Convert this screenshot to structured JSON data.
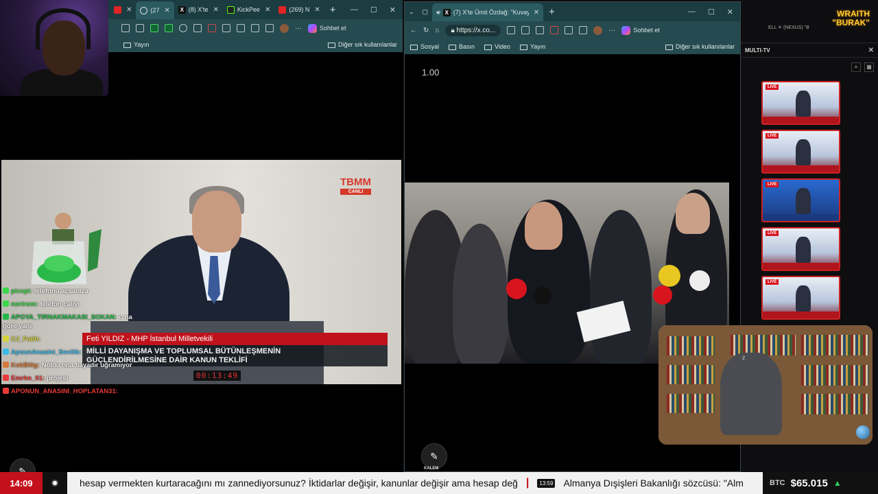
{
  "left_browser": {
    "tabs": [
      {
        "label": "(27",
        "icon": "youtube-icon"
      },
      {
        "label": "(8) X'te",
        "icon": "x-logo-icon"
      },
      {
        "label": "KickPee",
        "icon": "kick-icon"
      },
      {
        "label": "(269) N",
        "icon": "youtube-icon"
      }
    ],
    "sohbet_label": "Sohbet et",
    "bookmarks": [
      {
        "label": "Yayın"
      }
    ],
    "bookmarks_other": "Diğer sık kullanılanlar"
  },
  "right_browser": {
    "tabs": [
      {
        "label": "(7) X'te Ümit Özdağ: \"Kuvay-",
        "icon": "x-logo-icon"
      }
    ],
    "url": "https://x.co...",
    "sohbet_label": "Sohbet et",
    "bookmarks": [
      {
        "label": "Sosyal"
      },
      {
        "label": "Basın"
      },
      {
        "label": "Video"
      },
      {
        "label": "Yayın"
      }
    ],
    "bookmarks_other": "Diğer sık kullanılanlar",
    "zoom": "1.00"
  },
  "tbmm": {
    "logo": "TBMM",
    "logo_sub": "CANLI",
    "speaker_name": "Feti YILDIZ - MHP İstanbul Milletvekili",
    "bill_title_1": "MİLLİ DAYANIŞMA VE TOPLUMSAL BÜTÜNLEŞMENİN",
    "bill_title_2": "GÜÇLENDİRİLMESİNE DAİR KANUN TEKLİFİ",
    "clock": "00:13:49"
  },
  "chat": [
    {
      "user": "piccpi:",
      "text": "telefonu açsanıza",
      "color": "#3ad84a"
    },
    {
      "user": "nortrom:",
      "text": "telefon çalıyı",
      "color": "#3ad84a"
    },
    {
      "user": "APOYA_TIRNAKMAKASI_SOKAN:",
      "text": "o na gore yani",
      "color": "#26b84a"
    },
    {
      "user": "CJ_Fatih:",
      "text": "",
      "color": "#d4d43a"
    },
    {
      "user": "ApounAnasini_Sevilik:",
      "text": "",
      "color": "#3ab8e8"
    },
    {
      "user": "KokBilig:",
      "text": "Noldu ona bayadır uğramıyor",
      "color": "#d87a3a"
    },
    {
      "user": "Emrhn_01:",
      "text": "projesi",
      "color": "#e83a3a"
    },
    {
      "user": "APONUN_ANASINI_HOPLATAN31:",
      "text": "",
      "color": "#e83a3a"
    }
  ],
  "right_panel": {
    "title": "MULTI-TV",
    "top_text": "ELL   ✕ (NEXUS) \"B",
    "brand_1": "WRAITH",
    "brand_2": "\"BURAK\"",
    "live_label": "LIVE",
    "add_label": "+",
    "close_label": "✕"
  },
  "ticker": {
    "time": "14:09",
    "headline_1": "hesap vermekten kurtaracağını mı zannediyorsunuz? İktidarlar değişir, kanunlar değişir ama hesap değ",
    "stamp": "13:59",
    "headline_2": "Almanya Dışişleri Bakanlığı sözcüsü: \"Alm",
    "btc_label": "BTC",
    "btc_price": "$65.015",
    "btc_arrow": "▲"
  },
  "tools": {
    "kalem_label": "KALEM"
  },
  "colors": {
    "accent_red": "#c4101c",
    "browser_teal": "#1b3c40",
    "up_green": "#2fd05a"
  }
}
